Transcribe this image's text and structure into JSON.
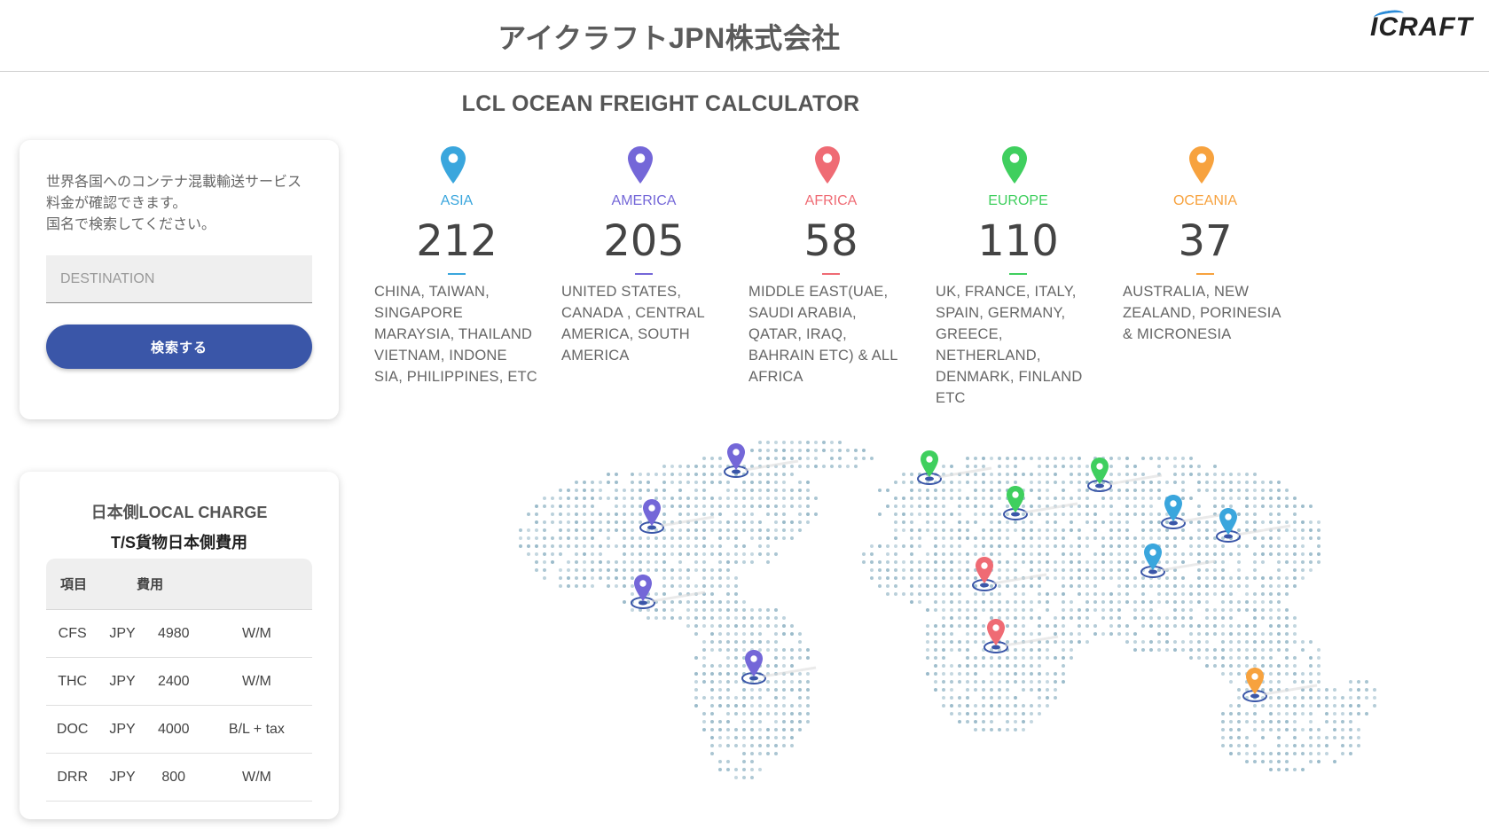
{
  "header": {
    "company_name": "アイクラフトJPN株式会社",
    "logo_text": "ICRAFT"
  },
  "calculator_title": "LCL OCEAN FREIGHT CALCULATOR",
  "search": {
    "intro_lines": [
      "世界各国へのコンテナ混載輸送サービス",
      "料金が確認できます。",
      "国名で検索してください。"
    ],
    "placeholder": "DESTINATION",
    "value": "",
    "button_label": "検索する"
  },
  "local_charge": {
    "title": "日本側LOCAL CHARGE",
    "subtitle": "T/S貨物日本側費用",
    "headers": [
      "項目",
      "費用",
      "",
      ""
    ],
    "rows": [
      {
        "item": "CFS",
        "currency": "JPY",
        "amount": "4980",
        "unit": "W/M"
      },
      {
        "item": "THC",
        "currency": "JPY",
        "amount": "2400",
        "unit": "W/M"
      },
      {
        "item": "DOC",
        "currency": "JPY",
        "amount": "4000",
        "unit": "B/L + tax"
      },
      {
        "item": "DRR",
        "currency": "JPY",
        "amount": "800",
        "unit": "W/M"
      }
    ]
  },
  "regions": [
    {
      "name": "ASIA",
      "count": "212",
      "color": "#3aa6dd",
      "lines": [
        "CHINA, TAIWAN,",
        "SINGAPORE",
        "MARAYSIA, THAILAND",
        "VIETNAM, INDONE",
        "SIA, PHILIPPINES, ETC"
      ]
    },
    {
      "name": "AMERICA",
      "count": "205",
      "color": "#7467d8",
      "lines": [
        "UNITED STATES,",
        "CANADA , CENTRAL",
        "AMERICA, SOUTH",
        "AMERICA"
      ]
    },
    {
      "name": "AFRICA",
      "count": "58",
      "color": "#ef6b74",
      "lines": [
        "MIDDLE EAST(UAE,",
        "SAUDI ARABIA,",
        "QATAR, IRAQ,",
        "BAHRAIN ETC) & ALL",
        "AFRICA"
      ]
    },
    {
      "name": "EUROPE",
      "count": "110",
      "color": "#3fcf5e",
      "lines": [
        "UK, FRANCE, ITALY,",
        "SPAIN, GERMANY,",
        "GREECE,",
        "NETHERLAND,",
        "DENMARK, FINLAND",
        "ETC"
      ]
    },
    {
      "name": "OCEANIA",
      "count": "37",
      "color": "#f7a23e",
      "lines": [
        "AUSTRALIA, NEW",
        "ZEALAND, PORINESIA",
        "& MICRONESIA"
      ]
    }
  ]
}
